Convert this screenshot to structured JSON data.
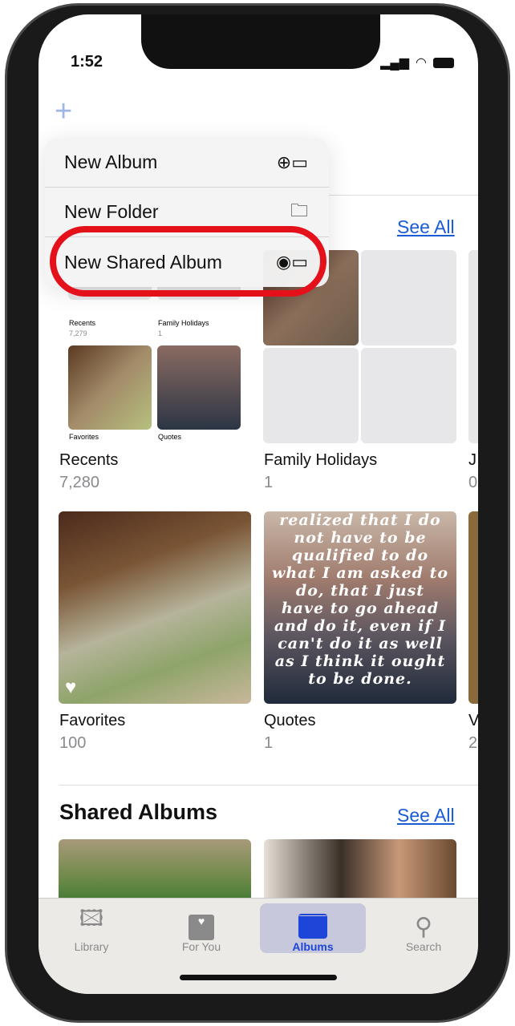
{
  "status": {
    "time": "1:52"
  },
  "toolbar": {
    "add_label": "+"
  },
  "menu": {
    "items": [
      {
        "label": "New Album",
        "icon": "album-add-icon"
      },
      {
        "label": "New Folder",
        "icon": "folder-add-icon"
      },
      {
        "label": "New Shared Album",
        "icon": "shared-album-icon"
      }
    ]
  },
  "preview": {
    "albums": [
      {
        "title": "Recents",
        "count": "7,279"
      },
      {
        "title": "Family Holidays",
        "count": "1"
      },
      {
        "title": "J",
        "count": "0"
      },
      {
        "title": "Favorites"
      },
      {
        "title": "Quotes"
      },
      {
        "title": "V"
      }
    ]
  },
  "my_albums": {
    "see_all": "See All",
    "albums": [
      {
        "title": "Recents",
        "count": "7,280"
      },
      {
        "title": "Family Holidays",
        "count": "1"
      },
      {
        "title": "J",
        "count": "0"
      },
      {
        "title": "Favorites",
        "count": "100"
      },
      {
        "title": "Quotes",
        "count": "1"
      },
      {
        "title": "V",
        "count": "2"
      }
    ]
  },
  "quote_text": "realized that I do not have to be qualified to do what I am asked to do, that I just have to go ahead and do it, even if I can't do it as well as I think it ought to be done.",
  "shared": {
    "title": "Shared Albums",
    "see_all": "See All"
  },
  "tabs": [
    {
      "label": "Library",
      "active": false
    },
    {
      "label": "For You",
      "active": false
    },
    {
      "label": "Albums",
      "active": true
    },
    {
      "label": "Search",
      "active": false
    }
  ],
  "colors": {
    "accent": "#1a5bd6",
    "highlight_ring": "#e4101a"
  }
}
